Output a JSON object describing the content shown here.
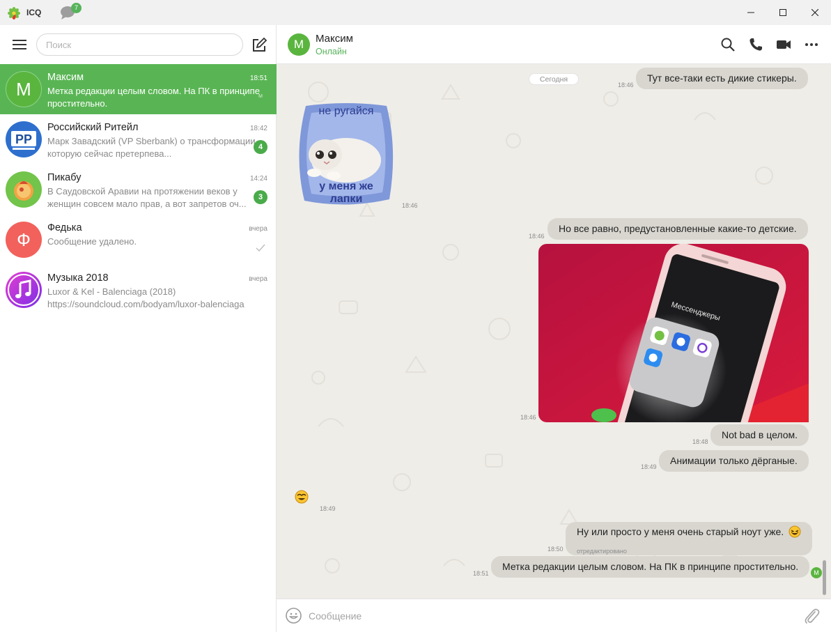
{
  "window": {
    "title": "ICQ",
    "notification_count": "7"
  },
  "sidebar": {
    "search_placeholder": "Поиск",
    "chats": [
      {
        "name": "Максим",
        "time": "18:51",
        "preview": "Метка редакции целым словом. На ПК в принципе простительно.",
        "avatar_letter": "М",
        "avatar_color": "#5ab53f",
        "mini_avatar": "М"
      },
      {
        "name": "Российский Ритейл",
        "time": "18:42",
        "preview": "Марк Завадский (VP Sberbank) о трансформации, которую сейчас претерпева...",
        "avatar_letter": "РР",
        "avatar_color": "#2e6fce",
        "unread": "4"
      },
      {
        "name": "Пикабу",
        "time": "14:24",
        "preview": "В Саудовской Аравии на протяжении веков у женщин совсем мало прав, а вот запретов оч...",
        "avatar_color": "#72c44b",
        "unread": "3"
      },
      {
        "name": "Федька",
        "time": "вчера",
        "preview": "Сообщение удалено.",
        "avatar_letter": "Ф",
        "avatar_color": "#f2615c"
      },
      {
        "name": "Музыка 2018",
        "time": "вчера",
        "preview": "Luxor & Kel - Balenciaga (2018) https://soundcloud.com/bodyam/luxor-balenciaga",
        "avatar_color": "#c03de0"
      }
    ]
  },
  "header": {
    "avatar_letter": "М",
    "name": "Максим",
    "status": "Онлайн"
  },
  "messages": {
    "date_label": "Сегодня",
    "m1": {
      "text": "Тут все-таки есть дикие стикеры.",
      "time": "18:46"
    },
    "sticker": {
      "line1": "не ругайся",
      "line2": "у меня же",
      "line3": "лапки",
      "time": "18:46"
    },
    "m2": {
      "text": "Но все равно, предустановленные какие-то детские.",
      "time": "18:46"
    },
    "photo": {
      "folder_label": "Мессенджеры",
      "time": "18:46"
    },
    "m3": {
      "text": "Not bad в целом.",
      "time": "18:48"
    },
    "m4": {
      "text": "Анимации только дёрганые.",
      "time": "18:49"
    },
    "emoji_msg": {
      "time": "18:49"
    },
    "m5": {
      "text": "Ну или просто у меня очень старый ноут уже.",
      "edited": "отредактировано",
      "time": "18:50"
    },
    "m6": {
      "text": "Метка редакции целым словом. На ПК в принципе простительно.",
      "time": "18:51"
    },
    "read_avatar": "М"
  },
  "composer": {
    "placeholder": "Сообщение"
  },
  "colors": {
    "accent": "#59b554",
    "bubble": "#d8d6cf",
    "chat_bg": "#efede8"
  }
}
